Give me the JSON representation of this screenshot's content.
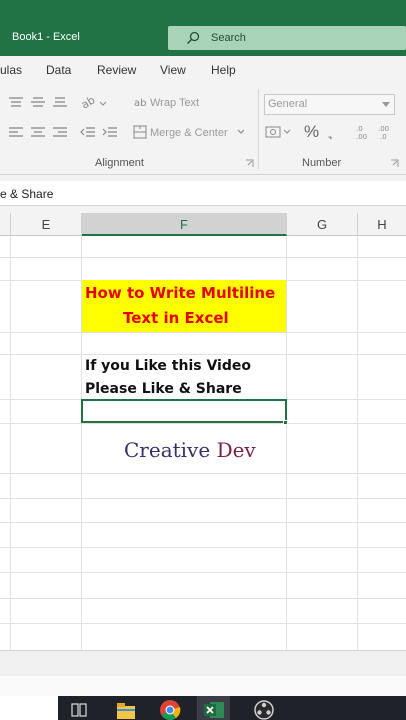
{
  "window": {
    "title": "Book1  -  Excel"
  },
  "search": {
    "label": "Search"
  },
  "menu": {
    "tabs": [
      "ulas",
      "Data",
      "Review",
      "View",
      "Help"
    ]
  },
  "ribbon": {
    "wrap_text_label": "Wrap Text",
    "merge_center_label": "Merge & Center",
    "number_format_value": "General",
    "percent_symbol": "%",
    "comma_symbol": "͉",
    "alignment_group_label": "Alignment",
    "number_group_label": "Number"
  },
  "formula_bar": {
    "text": "e & Share"
  },
  "columns": [
    "E",
    "F",
    "G",
    "H"
  ],
  "cells": {
    "heading_line1": "How to Write Multiline",
    "heading_line2": "Text in Excel",
    "body_line1": "If you Like this Video",
    "body_line2": "Please Like & Share"
  },
  "watermark": {
    "part1": "Creative",
    "part2": "Dev"
  },
  "colors": {
    "excel_green": "#217346",
    "highlight_yellow": "#ffff00",
    "heading_red": "#e60000"
  }
}
